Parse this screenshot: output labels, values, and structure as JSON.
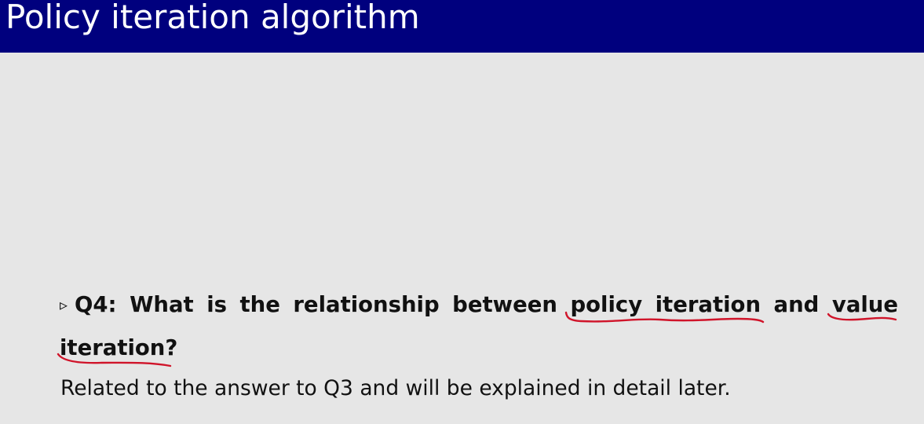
{
  "slide": {
    "title": "Policy iteration algorithm",
    "colors": {
      "title_bar": "#00007e",
      "title_text": "#ffffff",
      "background": "#e6e6e6",
      "body_text": "#111111",
      "annotation_ink": "#d0142a"
    },
    "question": {
      "bullet_icon": "triangle-right-outline",
      "bullet_glyph": "▹",
      "label": "Q4:",
      "text_before": "What is the relationship between",
      "term_1": "policy iteration",
      "connector": "and",
      "term_2_part_1": "value",
      "term_2_part_2": "iteration",
      "end": "?"
    },
    "answer": "Related to the answer to Q3 and will be explained in detail later.",
    "handwritten_underlines": [
      "policy iteration",
      "value",
      "iteration"
    ]
  }
}
